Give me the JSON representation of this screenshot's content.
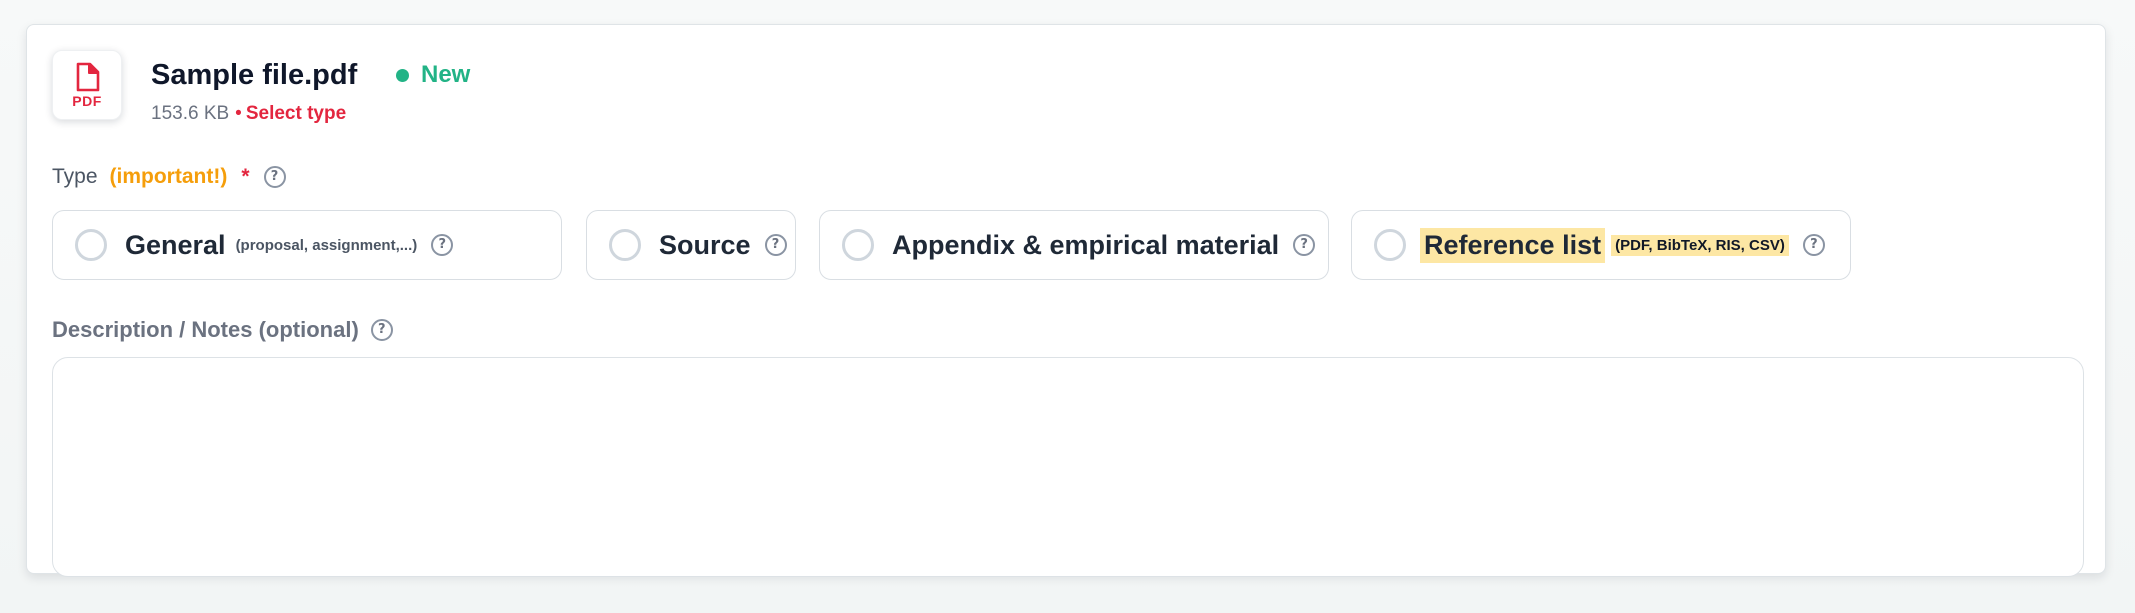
{
  "file": {
    "icon": "pdf-file-icon",
    "icon_label": "PDF",
    "name": "Sample file.pdf",
    "status": "New",
    "size": "153.6 KB",
    "separator": "•",
    "select_type": "Select type"
  },
  "type_section": {
    "label": "Type",
    "important": "(important!)",
    "required_mark": "*",
    "help_glyph": "?",
    "options": [
      {
        "label": "General",
        "hint": "(proposal, assignment,...)"
      },
      {
        "label": "Source",
        "hint": ""
      },
      {
        "label": "Appendix & empirical material",
        "hint": ""
      },
      {
        "label": "Reference list",
        "hint": "(PDF, BibTeX, RIS, CSV)"
      }
    ]
  },
  "description": {
    "label": "Description / Notes (optional)",
    "value": "",
    "placeholder": ""
  },
  "colors": {
    "accent_green": "#22b386",
    "accent_red": "#e3263f",
    "accent_orange": "#f59e0b",
    "highlight": "#fde7a4"
  }
}
